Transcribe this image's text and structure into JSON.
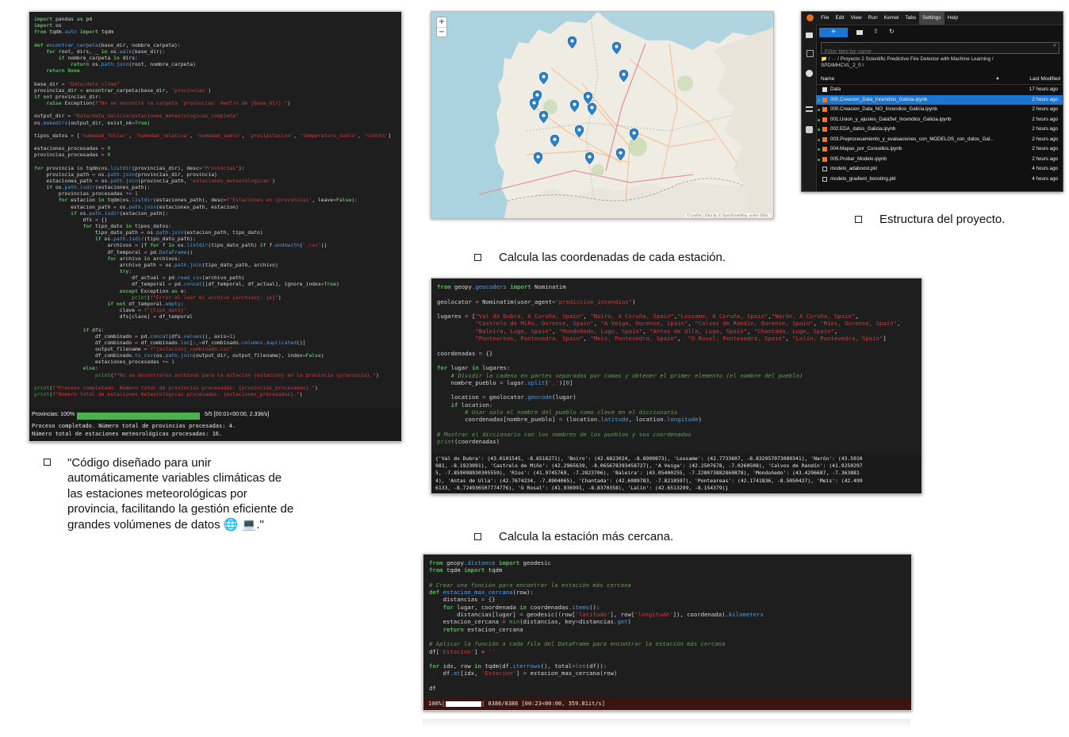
{
  "left_panel": {
    "code": "import pandas as pd\nimport os\nfrom tqdm.auto import tqdm\n\ndef encontrar_carpeta(base_dir, nombre_carpeta):\n    for root, dirs, _ in os.walk(base_dir):\n        if nombre_carpeta in dirs:\n            return os.path.join(root, nombre_carpeta)\n    return None\n\nbase_dir = \"Data/data_clima\"\nprovincias_dir = encontrar_carpeta(base_dir, 'provincias')\nif not provincias_dir:\n    raise Exception(f\"No se encontró la carpeta 'provincias' dentro de {base_dir}.\")\n\noutput_dir = \"Data/data_Galicia/estaciones_meteorologicas_completa\"\nos.makedirs(output_dir, exist_ok=True)\n\ntipos_datos = ['humedad_foliar', 'humedad_relativa', 'humedad_suelo', 'precipitacion', 'temperatura_suelo', 'viento']\n\nestaciones_procesadas = 0\nprovincias_procesadas = 0\n\nfor provincia in tqdm(os.listdir(provincias_dir), desc=\"Provincias\"):\n    provincia_path = os.path.join(provincias_dir, provincia)\n    estaciones_path = os.path.join(provincia_path, 'estaciones_meteorologicas')\n    if os.path.isdir(estaciones_path):\n        provincias_procesadas += 1\n        for estacion in tqdm(os.listdir(estaciones_path), desc=f'Estaciones en {provincia}', leave=False):\n            estacion_path = os.path.join(estaciones_path, estacion)\n            if os.path.isdir(estacion_path):\n                dfs = {}\n                for tipo_dato in tipos_datos:\n                    tipo_dato_path = os.path.join(estacion_path, tipo_dato)\n                    if os.path.isdir(tipo_dato_path):\n                        archivos = [f for f in os.listdir(tipo_dato_path) if f.endswith('.csv')]\n                        df_temporal = pd.DataFrame()\n                        for archivo in archivos:\n                            archivo_path = os.path.join(tipo_dato_path, archivo)\n                            try:\n                                df_actual = pd.read_csv(archivo_path)\n                                df_temporal = pd.concat([df_temporal, df_actual], ignore_index=True)\n                            except Exception as e:\n                                print(f\"Error al leer el archivo {archivo}: {e}\")\n                        if not df_temporal.empty:\n                            clave = f\"{tipo_dato}\"\n                            dfs[clave] = df_temporal\n\n                if dfs:\n                    df_combinado = pd.concat(dfs.values(), axis=1)\n                    df_combinado = df_combinado.loc[:,~df_combinado.columns.duplicated()]\n                    output_filename = f\"{estacion}_combinado.csv\"\n                    df_combinado.to_csv(os.path.join(output_dir, output_filename), index=False)\n                    estaciones_procesadas += 1\n                else:\n                    print(f\"No se encontraron archivos para la estación {estacion} en la provincia {provincia}.\")\n\nprint(f\"Proceso completado. Número total de provincias procesadas: {provincias_procesadas}.\")\nprint(f\"Número total de estaciones meteorológicas procesadas: {estaciones_procesadas}.\")",
    "progress_label": "Provincias: 100%",
    "progress_fraction": 1.0,
    "progress_stats": "5/5 [00:01<00:00, 2.33it/s]",
    "output_line1": "Proceso completado. Número total de provincias procesadas: 4.",
    "output_line2": "Número total de estaciones meteorológicas procesadas: 16."
  },
  "left_caption": {
    "line1": "\"Código diseñado para unir",
    "line2": "automáticamente variables climáticas de",
    "line3": "las estaciones meteorológicas por",
    "line4": "provincia, facilitando la gestión eficiente de",
    "line5": "grandes volúmenes de datos 🌐 💻.\""
  },
  "map": {
    "zoom_in": "+",
    "zoom_out": "−",
    "attribution": "© Leaflet | Data by © OpenStreetMap, under ODbL."
  },
  "file_browser": {
    "menu": [
      "File",
      "Edit",
      "View",
      "Run",
      "Kernel",
      "Tabs",
      "Settings",
      "Help"
    ],
    "filter_placeholder": "Filter files by name",
    "breadcrumb": "📁 / ··· / Proyecto 2 Scientific Predictive Fire Detector with Machine Learning / SPDIMHCVL_2_0 /",
    "col_name": "Name",
    "col_modified": "Last Modified",
    "files": [
      {
        "name": "Data",
        "modified": "17 hours ago",
        "kind": "folder",
        "dot": false,
        "selected": false
      },
      {
        "name": "000.Creacion_Data_Incendios_Galicia.ipynb",
        "modified": "2 hours ago",
        "kind": "nb",
        "dot": true,
        "selected": true
      },
      {
        "name": "000.Creacion_Data_NO_Incendios_Galicia.ipynb",
        "modified": "2 hours ago",
        "kind": "nb",
        "dot": true,
        "selected": false
      },
      {
        "name": "001.Union_y_ajustes_DataSet_Incendios_Galicia.ipynb",
        "modified": "2 hours ago",
        "kind": "nb",
        "dot": true,
        "selected": false
      },
      {
        "name": "002.EDA_datos_Galicia.ipynb",
        "modified": "2 hours ago",
        "kind": "nb",
        "dot": true,
        "selected": false
      },
      {
        "name": "003.Preprocesamiento_y_evaluaciones_con_MODELOS_con_datos_Gal...",
        "modified": "2 hours ago",
        "kind": "nb",
        "dot": true,
        "selected": false
      },
      {
        "name": "004.Mapas_por_Concellos.ipynb",
        "modified": "2 hours ago",
        "kind": "nb",
        "dot": true,
        "selected": false
      },
      {
        "name": "005.Probar_Modelo.ipynb",
        "modified": "2 hours ago",
        "kind": "nb",
        "dot": true,
        "selected": false
      },
      {
        "name": "modelo_adaboost.pkl",
        "modified": "4 hours ago",
        "kind": "file",
        "dot": false,
        "selected": false
      },
      {
        "name": "modelo_gradient_boosting.pkl",
        "modified": "4 hours ago",
        "kind": "file",
        "dot": false,
        "selected": false
      }
    ]
  },
  "captions": {
    "estructura": "Estructura del proyecto.",
    "coordenadas": "Calcula las coordenadas de cada estación.",
    "cercana": "Calcula la estación más cercana."
  },
  "geocode_panel": {
    "code": "from geopy.geocoders import Nominatim\n\ngeolocator = Nominatim(user_agent=\"prediccion_incendios\")\n\nlugares = [\"Val do Dubra, A Coruña, Spain\", \"Boiro, A Coruña, Spain\",\"Lousame, A Coruña, Spain\",\"Narón, A Coruña, Spain\",\n           \"Castrelo de Miño, Ourense, Spain\", \"A Veiga, Ourense, Spain\", \"Calvos de Randín, Ourense, Spain\", \"Ríos, Ourense, Spain\",\n           \"Baleira, Lugo, Spain\", \"Mondoñedo, Lugo, Spain\", \"Antas de Ulla, Lugo, Spain\", \"Chantada, Lugo, Spain\",\n           \"Ponteareas, Pontevedra, Spain\", \"Meis, Pontevedra, Spain\",  \"O Rosal, Pontevedra, Spain\", \"Lalín, Pontevedra, Spain\"]\n\ncoordenadas = {}\n\nfor lugar in lugares:\n    # Dividir la cadena en partes separadas por comas y obtener el primer elemento (el nombre del pueblo)\n    nombre_pueblo = lugar.split(',')[0]\n\n    location = geolocator.geocode(lugar)\n    if location:\n        # Usar solo el nombre del pueblo como clave en el diccionario\n        coordenadas[nombre_pueblo] = (location.latitude, location.longitude)\n\n# Mostrar el diccionario con los nombres de los pueblos y sus coordenadas\nprint(coordenadas)",
    "output": "{'Val do Dubra': (43.0101545, -8.6516271), 'Boiro': (42.6823024, -8.8909873), 'Lousame': (42.7733607, -8.832957073089341), 'Narón': (43.5010\n981, -8.1923091), 'Castrelo de Miño': (42.2965639, -8.065678393458727), 'A Veiga': (42.2507678, -7.0260508), 'Calvos de Randín': (41.9250297\n5, -7.859098930305559), 'Ríos': (41.9745769, -7.2823706), 'Baleira': (43.05400255, -7.228073882860878), 'Mondoñedo': (43.4296687, -7.363881\n4), 'Antas de Ulla': (42.7674234, -7.8904065), 'Chantada': (42.6089783, -7.8218597), 'Ponteareas': (42.1741836, -8.5050427), 'Meis': (42.499\n6133, -8.724936507774776), 'O Rosal': (41.936991, -8.8370358), 'Lalín': (42.6513299, -8.154379)}"
  },
  "nearest_panel": {
    "code": "from geopy.distance import geodesic\nfrom tqdm import tqdm\n\n# Crear una función para encontrar la estación más cercana\ndef estacion_mas_cercana(row):\n    distancias = {}\n    for lugar, coordenada in coordenadas.items():\n        distancias[lugar] = geodesic((row['latitude'], row['longitude']), coordenada).kilometers\n    estacion_cercana = min(distancias, key=distancias.get)\n    return estacion_cercana\n\n# Aplicar la función a cada fila del DataFrame para encontrar la estación más cercana\ndf['Estacion'] = ''\n\nfor idx, row in tqdm(df.iterrows(), total=len(df)):\n    df.at[idx, 'Estacion'] = estacion_mas_cercana(row)\n\ndf",
    "progress_label": "100%|",
    "progress_fraction": 1.0,
    "progress_stats": "| 8386/8386 [00:23<00:00, 359.81it/s]"
  }
}
